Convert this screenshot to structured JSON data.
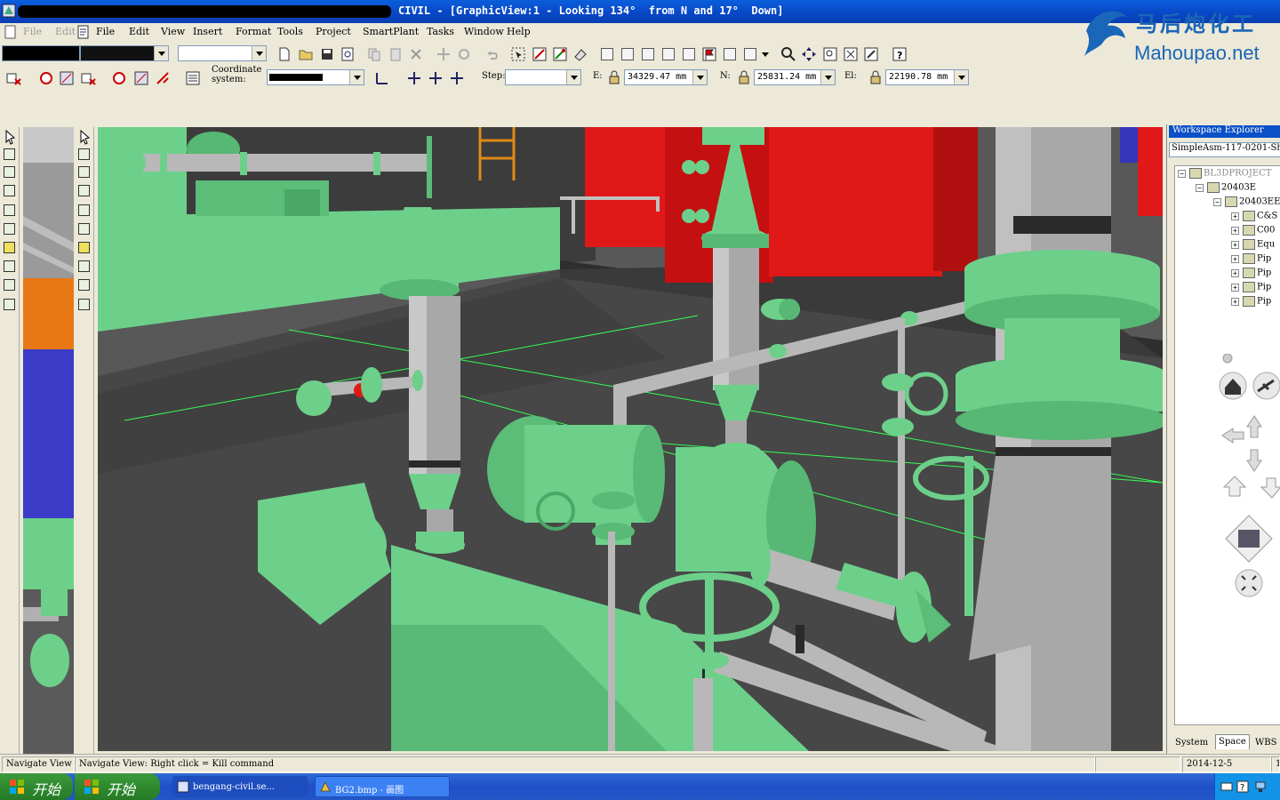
{
  "window": {
    "title": "bengang-civil - CIVIL - [GraphicView:1 - Looking 134°  from N and 17°  Down]",
    "title_visible": "CIVIL - [GraphicView:1 - Looking 134°  from N and 17°  Down]"
  },
  "watermark": {
    "cn": "马后炮化工",
    "en": "Mahoupao.net"
  },
  "menu": {
    "ghost": [
      "File",
      "Edit"
    ],
    "items": [
      "File",
      "Edit",
      "View",
      "Insert",
      "Format",
      "Tools",
      "Project",
      "SmartPlant",
      "Tasks",
      "Window",
      "Help"
    ]
  },
  "toolbar": {
    "combo1_value": "",
    "combo2_value": "",
    "coordinate_label": "Coordinate system:",
    "step_label": "Step:",
    "e_label": "E:",
    "e_value": "34329.47 mm",
    "n_label": "N:",
    "n_value": "25831.24 mm",
    "el_label": "El:",
    "el_value": "22190.78 mm"
  },
  "workspace": {
    "title": "Workspace Explorer",
    "filter": "SimpleAsm-117-0201-Sh",
    "tree": [
      {
        "label": "BL3DPROJECT",
        "level": 0
      },
      {
        "label": "20403E",
        "level": 1
      },
      {
        "label": "20403EE",
        "level": 2
      },
      {
        "label": "C&S",
        "level": 3
      },
      {
        "label": "C00",
        "level": 3
      },
      {
        "label": "Equ",
        "level": 3
      },
      {
        "label": "Pip",
        "level": 3
      },
      {
        "label": "Pip",
        "level": 3
      },
      {
        "label": "Pip",
        "level": 3
      },
      {
        "label": "Pip",
        "level": 3
      }
    ],
    "tabs": [
      "System",
      "Space",
      "WBS"
    ],
    "active_tab": "Space"
  },
  "status": {
    "left": "Navigate View",
    "main": "Navigate View: Right click = Kill command",
    "date": "2014-12-5",
    "extra": "1"
  },
  "taskbar": {
    "start_label": "开始",
    "tasks": [
      "bengang-civil.se...",
      "BG2.bmp - 画图"
    ]
  },
  "colors": {
    "equipment": "#6dd08a",
    "pipe": "#a8a8a8",
    "structure_red": "#e01818",
    "floor": "#474747",
    "titlebar": "#0846c4",
    "guide_lines": "#33ff55"
  }
}
